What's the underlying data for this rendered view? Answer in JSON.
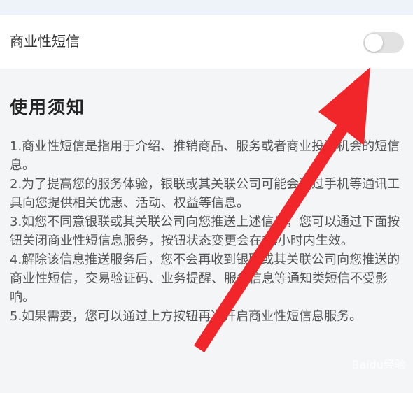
{
  "setting": {
    "label": "商业性短信",
    "toggle_on": false
  },
  "notice": {
    "title": "使用须知",
    "items": [
      "1.商业性短信是指用于介绍、推销商品、服务或者商业投资机会的短信息。",
      "2.为了提高您的服务体验，银联或其关联公司可能会通过手机等通讯工具向您提供相关优惠、活动、权益等信息。",
      "3.如您不同意银联或其关联公司向您推送上述信息，您可以通过下面按钮关闭商业性短信息服务，按钮状态变更会在24小时内生效。",
      "4.解除该信息推送服务后，您不会再收到银联或其关联公司向您推送的商业性短信，交易验证码、业务提醒、服务信息等通知类短信不受影响。",
      "5.如果需要，您可以通过上方按钮再次开启商业性短信息服务。"
    ]
  },
  "watermark": "Baidu经验",
  "colors": {
    "arrow": "#f0262a",
    "toggle_off": "#e2e2e2"
  }
}
